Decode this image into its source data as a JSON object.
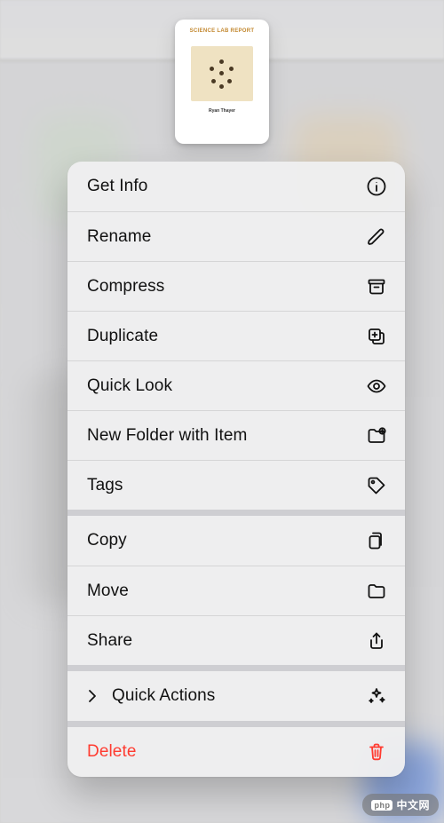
{
  "thumbnail": {
    "title": "SCIENCE LAB REPORT",
    "footer": "Ryan Thayer"
  },
  "menu": {
    "groups": [
      {
        "items": [
          {
            "key": "getinfo",
            "label": "Get Info",
            "icon": "info-icon"
          },
          {
            "key": "rename",
            "label": "Rename",
            "icon": "pencil-icon"
          },
          {
            "key": "compress",
            "label": "Compress",
            "icon": "archivebox-icon"
          },
          {
            "key": "duplicate",
            "label": "Duplicate",
            "icon": "duplicate-icon"
          },
          {
            "key": "quicklook",
            "label": "Quick Look",
            "icon": "eye-icon"
          },
          {
            "key": "newfolder",
            "label": "New Folder with Item",
            "icon": "folder-plus-icon"
          },
          {
            "key": "tags",
            "label": "Tags",
            "icon": "tag-icon"
          }
        ]
      },
      {
        "items": [
          {
            "key": "copy",
            "label": "Copy",
            "icon": "copy-icon"
          },
          {
            "key": "move",
            "label": "Move",
            "icon": "folder-icon"
          },
          {
            "key": "share",
            "label": "Share",
            "icon": "share-icon"
          }
        ]
      },
      {
        "items": [
          {
            "key": "quickactions",
            "label": "Quick Actions",
            "icon": "sparkles-icon",
            "hasChevron": true
          }
        ]
      },
      {
        "items": [
          {
            "key": "delete",
            "label": "Delete",
            "icon": "trash-icon",
            "destructive": true
          }
        ]
      }
    ]
  },
  "watermark": {
    "prefix": "php",
    "text": "中文网"
  }
}
